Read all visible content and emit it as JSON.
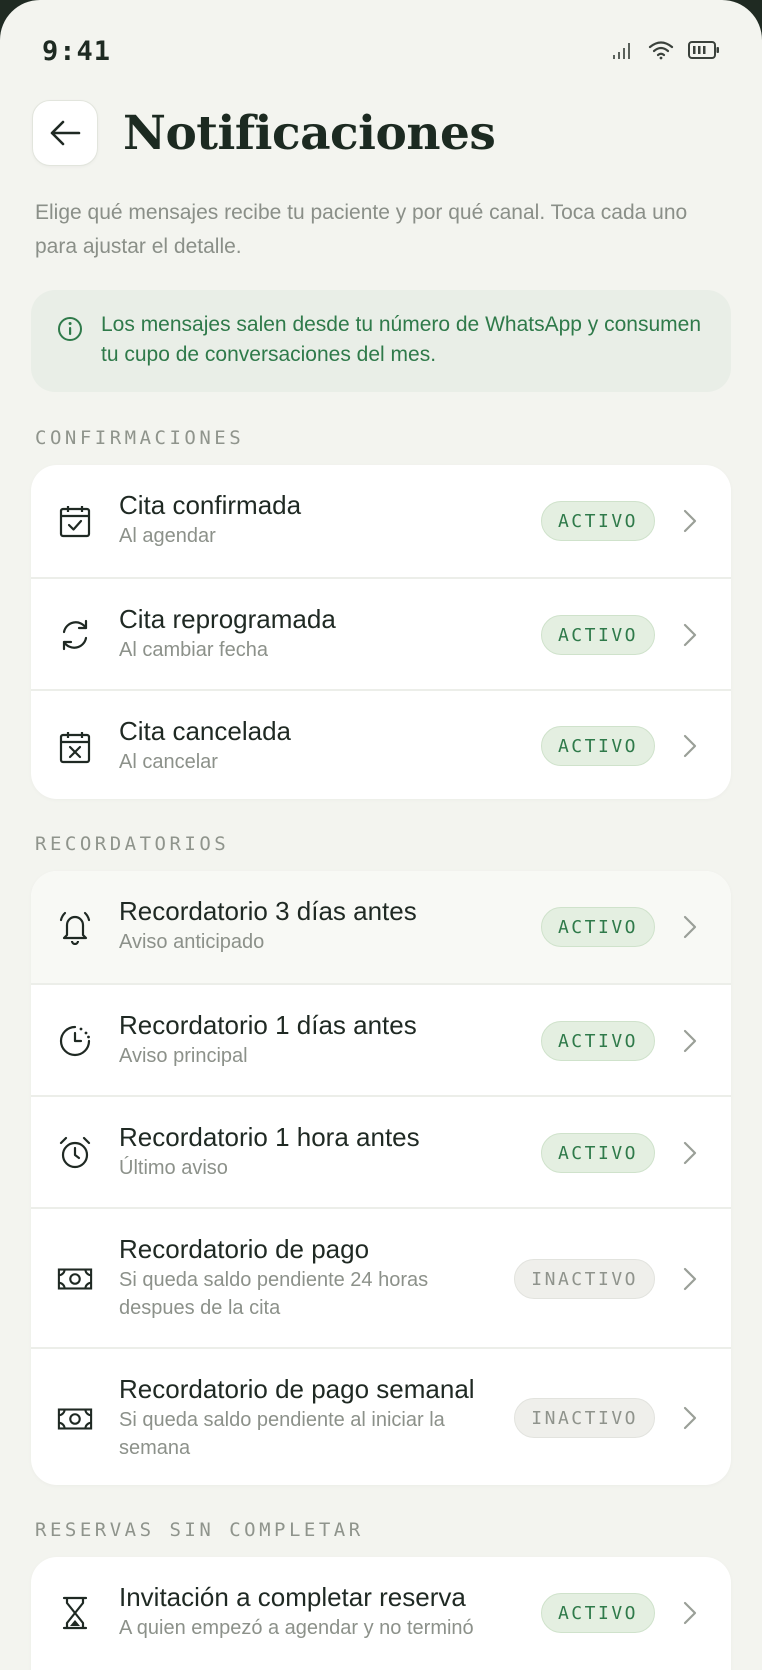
{
  "status_bar": {
    "time": "9:41"
  },
  "header": {
    "title": "Notificaciones"
  },
  "intro": "Elige qué mensajes recibe tu paciente y por qué canal. Toca cada uno para ajustar el detalle.",
  "info": {
    "text": "Los mensajes salen desde tu número de WhatsApp y consumen tu cupo de conversaciones del mes.",
    "color": "#2f7a4a"
  },
  "sections": [
    {
      "label": "CONFIRMACIONES",
      "items": [
        {
          "icon": "calendar-check-icon",
          "title": "Cita confirmada",
          "subtitle": "Al agendar",
          "status": "ACTIVO"
        },
        {
          "icon": "refresh-icon",
          "title": "Cita reprogramada",
          "subtitle": "Al cambiar fecha",
          "status": "ACTIVO"
        },
        {
          "icon": "calendar-x-icon",
          "title": "Cita cancelada",
          "subtitle": "Al cancelar",
          "status": "ACTIVO"
        }
      ]
    },
    {
      "label": "RECORDATORIOS",
      "items": [
        {
          "icon": "bell-icon",
          "title": "Recordatorio 3 días antes",
          "subtitle": "Aviso anticipado",
          "status": "ACTIVO"
        },
        {
          "icon": "clock-dashed-icon",
          "title": "Recordatorio 1 días antes",
          "subtitle": "Aviso principal",
          "status": "ACTIVO"
        },
        {
          "icon": "alarm-clock-icon",
          "title": "Recordatorio 1 hora antes",
          "subtitle": "Último aviso",
          "status": "ACTIVO"
        },
        {
          "icon": "money-icon",
          "title": "Recordatorio de pago",
          "subtitle_lines": [
            "Si queda saldo pendiente 24 horas",
            "despues de la cita"
          ],
          "status": "INACTIVO"
        },
        {
          "icon": "money-icon",
          "title": "Recordatorio de pago semanal",
          "subtitle_lines": [
            "Si queda saldo pendiente al iniciar la",
            "semana"
          ],
          "status": "INACTIVO"
        }
      ]
    },
    {
      "label": "RESERVAS SIN COMPLETAR",
      "items": [
        {
          "icon": "hourglass-icon",
          "title": "Invitación a completar reserva",
          "subtitle": "A quien empezó a agendar y no terminó",
          "status": "ACTIVO"
        }
      ]
    }
  ]
}
